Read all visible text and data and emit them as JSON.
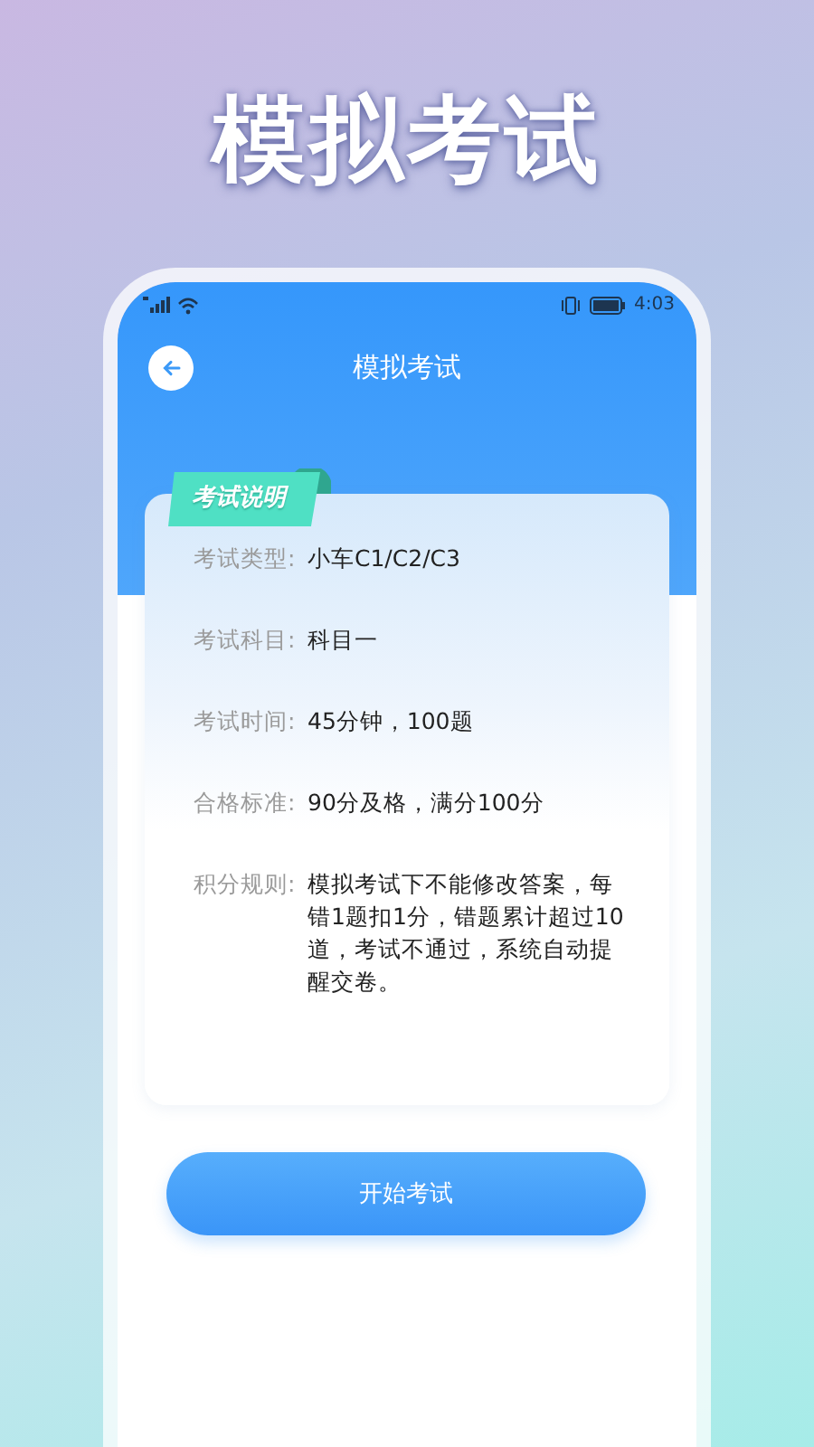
{
  "headline": "模拟考试",
  "status_bar": {
    "time": "4:03"
  },
  "nav": {
    "title": "模拟考试"
  },
  "card": {
    "tag": "考试说明",
    "rows": [
      {
        "label": "考试类型:",
        "value": "小车C1/C2/C3"
      },
      {
        "label": "考试科目:",
        "value": "科目一"
      },
      {
        "label": "考试时间:",
        "value": "45分钟，100题"
      },
      {
        "label": "合格标准:",
        "value": "90分及格，满分100分"
      },
      {
        "label": "积分规则:",
        "value": "模拟考试下不能修改答案，每错1题扣1分，错题累计超过10道，考试不通过，系统自动提醒交卷。"
      }
    ]
  },
  "start_button": "开始考试"
}
